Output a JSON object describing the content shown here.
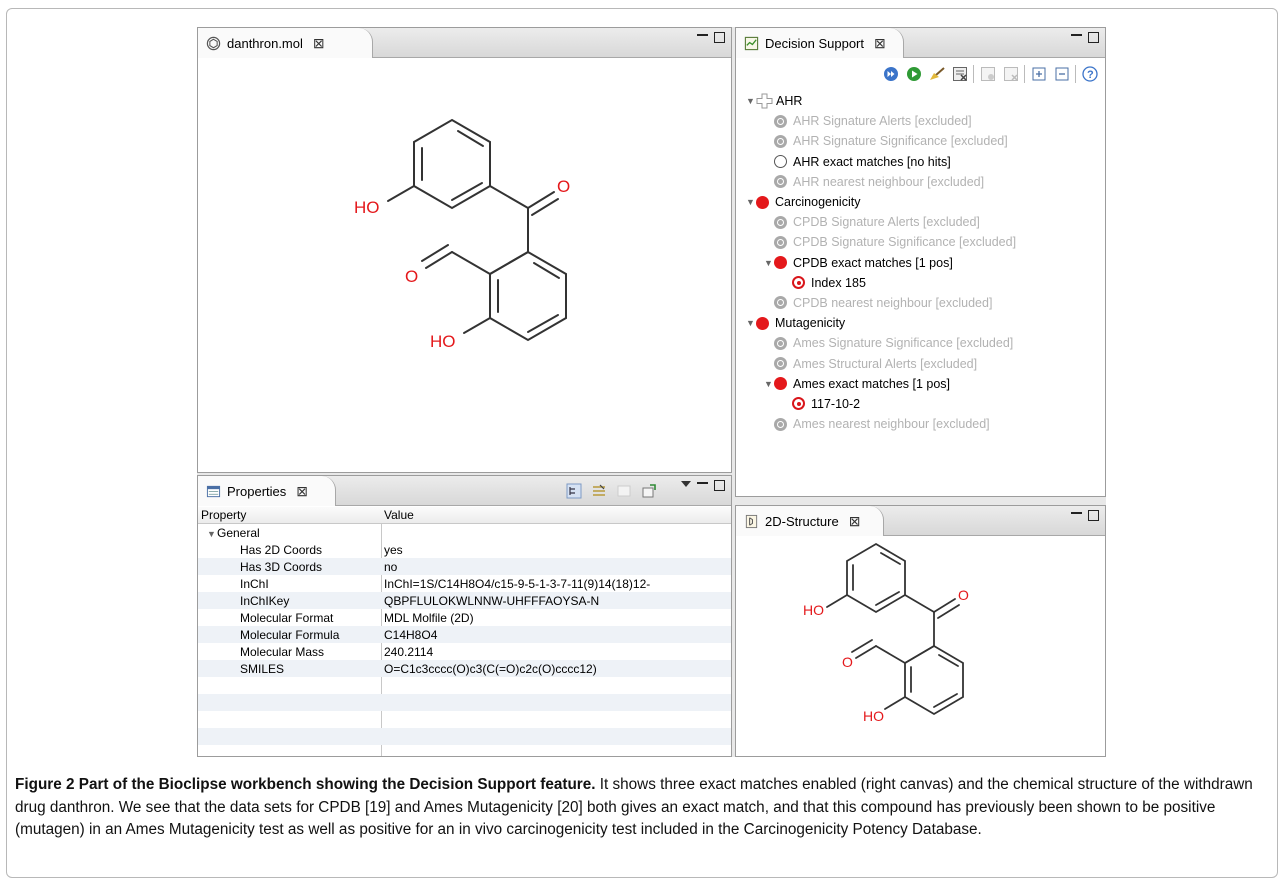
{
  "editor": {
    "tab_label": "danthron.mol",
    "close_glyph": "⊠"
  },
  "molecule": {
    "labels": [
      "HO",
      "O",
      "O",
      "HO"
    ],
    "atom_color": "#e4181b"
  },
  "decision_support": {
    "tab_label": "Decision Support",
    "close_glyph": "⊠",
    "toolbar_icons": [
      "fast-forward-icon",
      "run-icon",
      "broom-icon",
      "clear-results-icon",
      "add-test-icon",
      "remove-test-icon",
      "expand-all-icon",
      "collapse-all-icon",
      "help-icon"
    ],
    "tree": [
      {
        "level": 0,
        "twisty": "▼",
        "status": "plus",
        "label": "AHR",
        "excluded": false
      },
      {
        "level": 1,
        "twisty": "",
        "status": "gray",
        "label": "AHR Signature Alerts [excluded]",
        "excluded": true
      },
      {
        "level": 1,
        "twisty": "",
        "status": "gray",
        "label": "AHR Signature Significance [excluded]",
        "excluded": true
      },
      {
        "level": 1,
        "twisty": "",
        "status": "empty",
        "label": "AHR exact matches [no hits]",
        "excluded": false
      },
      {
        "level": 1,
        "twisty": "",
        "status": "gray",
        "label": "AHR nearest neighbour [excluded]",
        "excluded": true
      },
      {
        "level": 0,
        "twisty": "▼",
        "status": "red",
        "label": "Carcinogenicity",
        "excluded": false
      },
      {
        "level": 1,
        "twisty": "",
        "status": "gray",
        "label": "CPDB Signature Alerts [excluded]",
        "excluded": true
      },
      {
        "level": 1,
        "twisty": "",
        "status": "gray",
        "label": "CPDB Signature Significance [excluded]",
        "excluded": true
      },
      {
        "level": 1,
        "twisty": "▼",
        "status": "red",
        "label": "CPDB exact matches [1 pos]",
        "excluded": false
      },
      {
        "level": 2,
        "twisty": "",
        "status": "target",
        "label": "Index 185",
        "excluded": false
      },
      {
        "level": 1,
        "twisty": "",
        "status": "gray",
        "label": "CPDB nearest neighbour [excluded]",
        "excluded": true
      },
      {
        "level": 0,
        "twisty": "▼",
        "status": "red",
        "label": "Mutagenicity",
        "excluded": false
      },
      {
        "level": 1,
        "twisty": "",
        "status": "gray",
        "label": "Ames Signature Significance [excluded]",
        "excluded": true
      },
      {
        "level": 1,
        "twisty": "",
        "status": "gray",
        "label": "Ames Structural Alerts [excluded]",
        "excluded": true
      },
      {
        "level": 1,
        "twisty": "▼",
        "status": "red",
        "label": "Ames exact matches [1 pos]",
        "excluded": false
      },
      {
        "level": 2,
        "twisty": "",
        "status": "target",
        "label": "117-10-2",
        "excluded": false
      },
      {
        "level": 1,
        "twisty": "",
        "status": "gray",
        "label": "Ames nearest neighbour [excluded]",
        "excluded": true
      }
    ]
  },
  "properties": {
    "tab_label": "Properties",
    "close_glyph": "⊠",
    "col_property": "Property",
    "col_value": "Value",
    "group_label": "General",
    "rows": [
      {
        "property": "Has 2D Coords",
        "value": "yes"
      },
      {
        "property": "Has 3D Coords",
        "value": "no"
      },
      {
        "property": "InChI",
        "value": "InChI=1S/C14H8O4/c15-9-5-1-3-7-11(9)14(18)12-"
      },
      {
        "property": "InChIKey",
        "value": "QBPFLULOKWLNNW-UHFFFAOYSA-N"
      },
      {
        "property": "Molecular Format",
        "value": "MDL Molfile (2D)"
      },
      {
        "property": "Molecular Formula",
        "value": "C14H8O4"
      },
      {
        "property": "Molecular Mass",
        "value": "240.2114"
      },
      {
        "property": "SMILES",
        "value": "O=C1c3cccc(O)c3(C(=O)c2c(O)cccc12)"
      }
    ]
  },
  "structure2d": {
    "tab_label": "2D-Structure",
    "close_glyph": "⊠"
  },
  "caption": {
    "bold": "Figure 2 Part of the Bioclipse workbench showing the Decision Support feature.",
    "text": " It shows three exact matches enabled (right canvas) and the chemical structure of the withdrawn drug danthron. We see that the data sets for CPDB [19] and Ames Mutagenicity [20] both gives an exact match, and that this compound has previously been shown to be positive (mutagen) in an Ames Mutagenicity test as well as positive for an in vivo carcinogenicity test included in the Carcinogenicity Potency Database."
  }
}
